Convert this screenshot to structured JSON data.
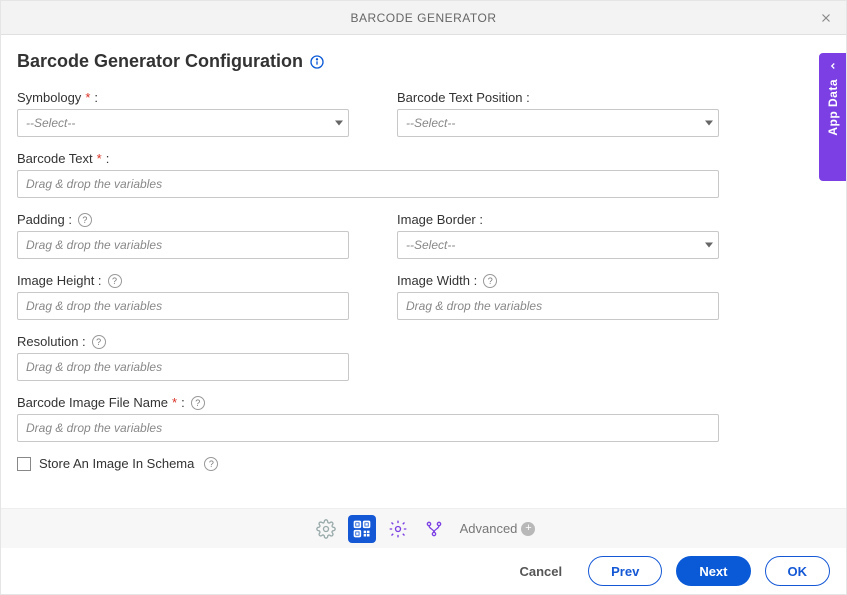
{
  "header": {
    "title": "BARCODE GENERATOR"
  },
  "page_title": "Barcode Generator Configuration",
  "side_tab": {
    "label": "App Data"
  },
  "fields": {
    "symbology": {
      "label": "Symbology",
      "required": "*",
      "colon": ":",
      "placeholder": "--Select--"
    },
    "barcode_text_position": {
      "label": "Barcode Text Position :",
      "placeholder": "--Select--"
    },
    "barcode_text": {
      "label": "Barcode Text",
      "required": "*",
      "colon": ":",
      "placeholder": "Drag & drop the variables"
    },
    "padding": {
      "label": "Padding :",
      "placeholder": "Drag & drop the variables"
    },
    "image_border": {
      "label": "Image Border :",
      "placeholder": "--Select--"
    },
    "image_height": {
      "label": "Image Height :",
      "placeholder": "Drag & drop the variables"
    },
    "image_width": {
      "label": "Image Width :",
      "placeholder": "Drag & drop the variables"
    },
    "resolution": {
      "label": "Resolution :",
      "placeholder": "Drag & drop the variables"
    },
    "barcode_image_file_name": {
      "label": "Barcode Image File Name",
      "required": "*",
      "colon": ":",
      "placeholder": "Drag & drop the variables"
    },
    "store_image": {
      "label": "Store An Image In Schema"
    }
  },
  "toolbar": {
    "advanced_label": "Advanced"
  },
  "footer": {
    "cancel": "Cancel",
    "prev": "Prev",
    "next": "Next",
    "ok": "OK"
  }
}
